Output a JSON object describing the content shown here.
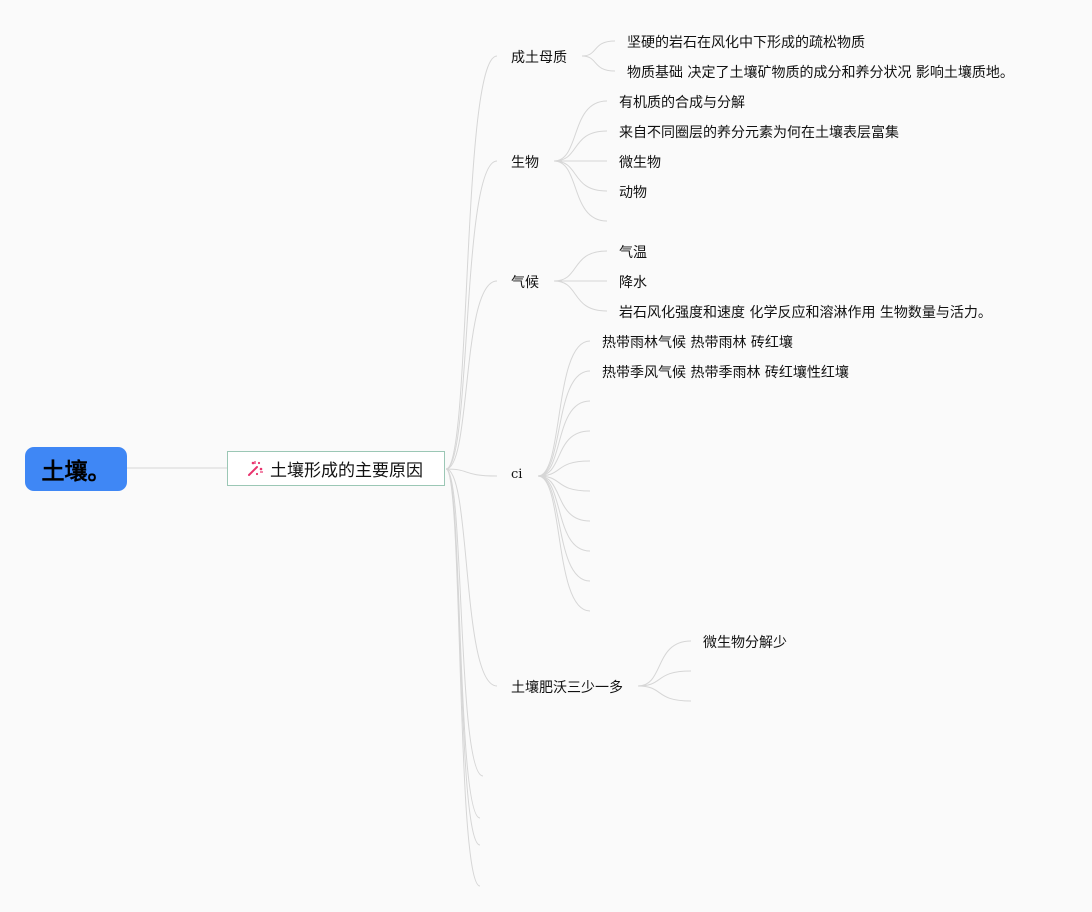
{
  "root": {
    "label": "土壤。"
  },
  "main_topic": {
    "label": "土壤形成的主要原因",
    "icon": "magic-wand-icon"
  },
  "branches": [
    {
      "label": "成土母质",
      "children": [
        "坚硬的岩石在风化中下形成的疏松物质",
        "物质基础 决定了土壤矿物质的成分和养分状况 影响土壤质地。"
      ]
    },
    {
      "label": "生物",
      "children": [
        "有机质的合成与分解",
        "来自不同圈层的养分元素为何在土壤表层富集",
        "微生物",
        "动物",
        ""
      ]
    },
    {
      "label": "气候",
      "children": [
        "气温",
        "降水",
        "岩石风化强度和速度 化学反应和溶淋作用 生物数量与活力。"
      ]
    },
    {
      "label": "ci",
      "children": [
        "热带雨林气候 热带雨林 砖红壤",
        "热带季风气候 热带季雨林 砖红壤性红壤",
        "",
        "",
        "",
        "",
        "",
        "",
        "",
        ""
      ]
    },
    {
      "label": "土壤肥沃三少一多",
      "children": [
        "微生物分解少",
        "",
        ""
      ]
    },
    {
      "label": "",
      "children": []
    },
    {
      "label": "",
      "children": []
    },
    {
      "label": "",
      "children": []
    },
    {
      "label": "",
      "children": []
    }
  ],
  "colors": {
    "root_bg": "#3f87f5",
    "main_border": "#9bc7b5",
    "link": "#d6d6d6",
    "icon": "#e8336d"
  }
}
